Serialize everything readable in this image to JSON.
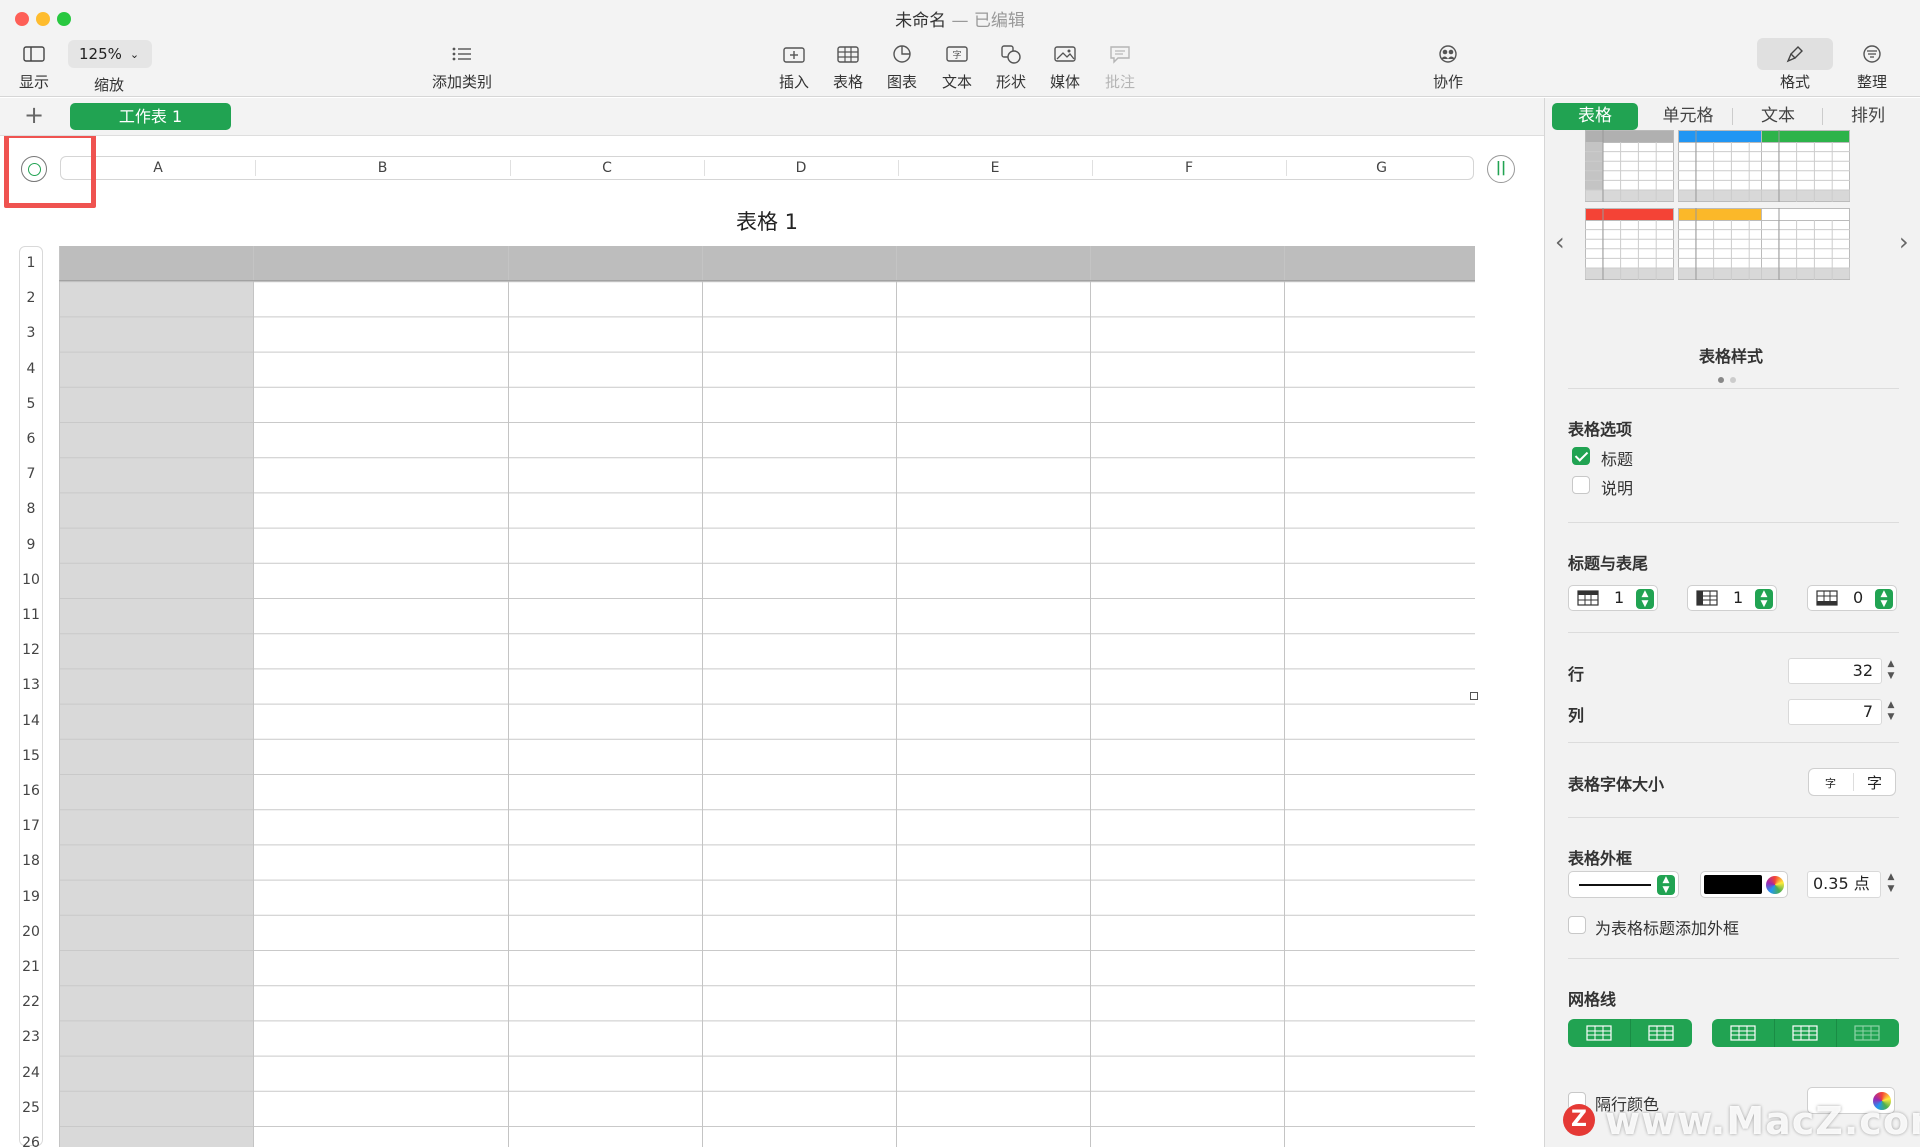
{
  "window": {
    "title": "未命名",
    "status": "已编辑",
    "separator": "—"
  },
  "toolbar": {
    "view_label": "显示",
    "zoom_value": "125%",
    "zoom_label": "缩放",
    "add_category_label": "添加类别",
    "insert_label": "插入",
    "table_label": "表格",
    "chart_label": "图表",
    "text_label": "文本",
    "shape_label": "形状",
    "media_label": "媒体",
    "comment_label": "批注",
    "collaborate_label": "协作",
    "format_label": "格式",
    "organize_label": "整理"
  },
  "sheets": {
    "add": "+",
    "active_tab": "工作表 1"
  },
  "table": {
    "title": "表格 1",
    "columns": [
      "A",
      "B",
      "C",
      "D",
      "E",
      "F",
      "G"
    ],
    "rows": [
      "1",
      "2",
      "3",
      "4",
      "5",
      "6",
      "7",
      "8",
      "9",
      "10",
      "11",
      "12",
      "13",
      "14",
      "15",
      "16",
      "17",
      "18",
      "19",
      "20",
      "21",
      "22",
      "23",
      "24",
      "25",
      "26"
    ]
  },
  "sidebar": {
    "tabs": [
      "表格",
      "单元格",
      "文本",
      "排列"
    ],
    "styles_label": "表格样式",
    "style_accent_colors": [
      "#b0b0b0",
      "#2196f3",
      "#2db34a",
      "#f44336",
      "#fbb829",
      "#ffffff"
    ],
    "table_options": {
      "title": "表格选项",
      "caption_title": "标题",
      "caption_desc": "说明"
    },
    "headers_footers": {
      "title": "标题与表尾",
      "header_rows": "1",
      "header_cols": "1",
      "footer_rows": "0"
    },
    "rows_label": "行",
    "rows_value": "32",
    "cols_label": "列",
    "cols_value": "7",
    "font_size": {
      "label": "表格字体大小",
      "small": "字",
      "large": "字"
    },
    "outline": {
      "title": "表格外框",
      "width": "0.35 点",
      "title_outline": "为表格标题添加外框"
    },
    "gridlines": {
      "title": "网格线"
    },
    "alt_rows": {
      "label": "隔行颜色"
    }
  },
  "watermark": {
    "text": "www.MacZ.com",
    "logo": "Z"
  }
}
